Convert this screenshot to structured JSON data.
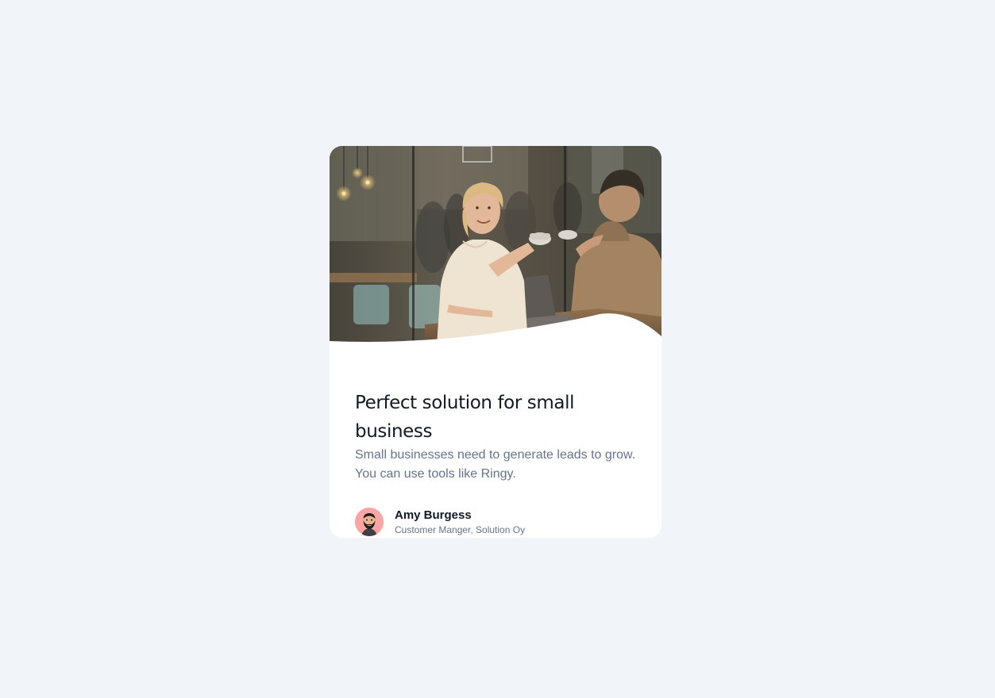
{
  "card": {
    "title": "Perfect solution for small business",
    "description": "Small businesses need to generate leads to grow. You can use tools like Ringy.",
    "author": {
      "name": "Amy Burgess",
      "role": "Customer Manger, Solution Oy"
    }
  },
  "colors": {
    "page_background": "#f1f5f9",
    "card_background": "#ffffff",
    "title": "#111827",
    "description": "#64748b",
    "avatar_background": "#fca5a5"
  },
  "icons": {
    "photo": "cafe-coffee-meeting-photo",
    "avatar": "bearded-man-avatar-icon"
  }
}
